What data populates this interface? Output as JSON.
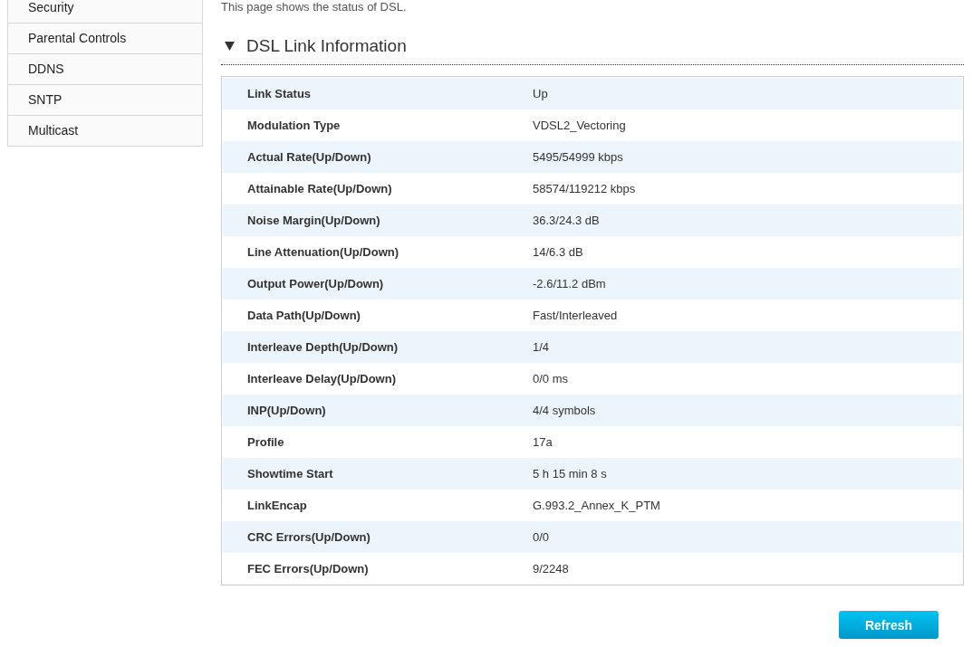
{
  "sidebar": {
    "items": [
      {
        "label": "Security"
      },
      {
        "label": "Parental Controls"
      },
      {
        "label": "DDNS"
      },
      {
        "label": "SNTP"
      },
      {
        "label": "Multicast"
      }
    ]
  },
  "intro": "This page shows the status of DSL.",
  "section": {
    "title": "DSL Link Information",
    "expanded": true,
    "rows": [
      {
        "label": "Link Status",
        "value": "Up"
      },
      {
        "label": "Modulation Type",
        "value": "VDSL2_Vectoring"
      },
      {
        "label": "Actual Rate(Up/Down)",
        "value": "5495/54999 kbps"
      },
      {
        "label": "Attainable Rate(Up/Down)",
        "value": "58574/119212 kbps"
      },
      {
        "label": "Noise Margin(Up/Down)",
        "value": "36.3/24.3 dB"
      },
      {
        "label": "Line Attenuation(Up/Down)",
        "value": "14/6.3 dB"
      },
      {
        "label": "Output Power(Up/Down)",
        "value": "-2.6/11.2 dBm"
      },
      {
        "label": "Data Path(Up/Down)",
        "value": "Fast/Interleaved"
      },
      {
        "label": "Interleave Depth(Up/Down)",
        "value": "1/4"
      },
      {
        "label": "Interleave Delay(Up/Down)",
        "value": "0/0 ms"
      },
      {
        "label": "INP(Up/Down)",
        "value": "4/4 symbols"
      },
      {
        "label": "Profile",
        "value": "17a"
      },
      {
        "label": "Showtime Start",
        "value": "5 h 15 min 8 s"
      },
      {
        "label": "LinkEncap",
        "value": "G.993.2_Annex_K_PTM"
      },
      {
        "label": "CRC Errors(Up/Down)",
        "value": "0/0"
      },
      {
        "label": "FEC Errors(Up/Down)",
        "value": "9/2248"
      }
    ]
  },
  "buttons": [
    {
      "label": "Refresh"
    }
  ]
}
